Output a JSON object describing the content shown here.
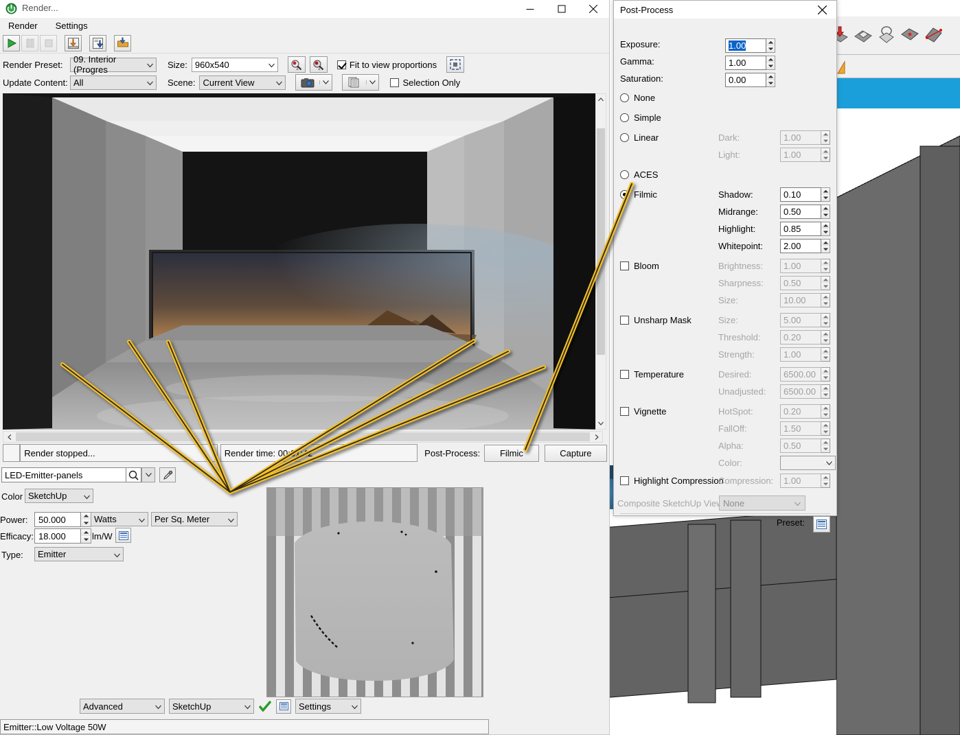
{
  "window": {
    "title": "Render...",
    "app_icon": "power-icon",
    "minimize": "minimize-icon",
    "maximize": "maximize-icon",
    "close": "close-icon"
  },
  "menu": {
    "items": [
      "Render",
      "Settings"
    ]
  },
  "toolbar": {
    "buttons": [
      {
        "name": "play-render-button",
        "icon": "play-icon",
        "enabled": true
      },
      {
        "name": "pause-render-button",
        "icon": "pause-icon",
        "enabled": false
      },
      {
        "name": "stop-render-button",
        "icon": "stop-icon",
        "enabled": false
      },
      {
        "name": "save-image-button",
        "icon": "save-image-icon",
        "enabled": true
      },
      {
        "name": "save-channels-button",
        "icon": "save-channels-icon",
        "enabled": true
      },
      {
        "name": "open-image-button",
        "icon": "open-folder-icon",
        "enabled": true
      }
    ]
  },
  "options": {
    "render_preset_label": "Render Preset:",
    "render_preset_value": "09. Interior (Progres",
    "size_label": "Size:",
    "size_value": "960x540",
    "update_content_label": "Update Content:",
    "update_content_value": "All",
    "scene_label": "Scene:",
    "scene_value": "Current View",
    "fit_to_view_label": "Fit to view proportions",
    "fit_to_view_checked": true,
    "selection_only_label": "Selection Only",
    "selection_only_checked": false,
    "zoom_in_icon": "zoom-in-icon",
    "zoom_out_icon": "zoom-out-icon",
    "fit_region_icon": "fit-region-icon",
    "camera_icon": "camera-icon",
    "channels_icon": "channels-icon"
  },
  "status": {
    "render_state": "Render stopped...",
    "render_time": "Render time: 00:01:42",
    "post_process_label": "Post-Process:",
    "post_process_value": "Filmic",
    "capture_label": "Capture"
  },
  "material": {
    "name": "LED-Emitter-panels",
    "search_icon": "search-icon",
    "dropdown_icon": "chevron-down-icon",
    "picker_icon": "eyedropper-icon",
    "color_label": "Color",
    "color_value": "SketchUp",
    "power_label": "Power:",
    "power_value": "50.000",
    "power_unit": "Watts",
    "power_area": "Per Sq. Meter",
    "efficacy_label": "Efficacy:",
    "efficacy_value": "18.000",
    "efficacy_unit": "lm/W",
    "efficacy_list_icon": "list-icon",
    "type_label": "Type:",
    "type_value": "Emitter",
    "bottom_mode": "Advanced",
    "bottom_source": "SketchUp",
    "apply_icon": "green-check-icon",
    "list_icon": "list-icon",
    "settings_label": "Settings",
    "statusbar_text": "Emitter::Low Voltage 50W"
  },
  "post_process": {
    "title": "Post-Process",
    "close_icon": "close-icon",
    "exposure_label": "Exposure:",
    "exposure_value": "1.00",
    "gamma_label": "Gamma:",
    "gamma_value": "1.00",
    "saturation_label": "Saturation:",
    "saturation_value": "0.00",
    "tonemap_options": [
      {
        "label": "None",
        "selected": false
      },
      {
        "label": "Simple",
        "selected": false
      },
      {
        "label": "Linear",
        "selected": false
      },
      {
        "label": "ACES",
        "selected": false
      },
      {
        "label": "Filmic",
        "selected": true
      }
    ],
    "linear_params": [
      {
        "label": "Dark:",
        "value": "1.00",
        "enabled": false
      },
      {
        "label": "Light:",
        "value": "1.00",
        "enabled": false
      }
    ],
    "filmic_params": [
      {
        "label": "Shadow:",
        "value": "0.10",
        "enabled": true
      },
      {
        "label": "Midrange:",
        "value": "0.50",
        "enabled": true
      },
      {
        "label": "Highlight:",
        "value": "0.85",
        "enabled": true
      },
      {
        "label": "Whitepoint:",
        "value": "2.00",
        "enabled": true
      }
    ],
    "bloom_label": "Bloom",
    "bloom_checked": false,
    "bloom_params": [
      {
        "label": "Brightness:",
        "value": "1.00",
        "enabled": false
      },
      {
        "label": "Sharpness:",
        "value": "0.50",
        "enabled": false
      },
      {
        "label": "Size:",
        "value": "10.00",
        "enabled": false
      }
    ],
    "unsharp_label": "Unsharp Mask",
    "unsharp_checked": false,
    "unsharp_params": [
      {
        "label": "Size:",
        "value": "5.00",
        "enabled": false
      },
      {
        "label": "Threshold:",
        "value": "0.20",
        "enabled": false
      },
      {
        "label": "Strength:",
        "value": "1.00",
        "enabled": false
      }
    ],
    "temperature_label": "Temperature",
    "temperature_checked": false,
    "temperature_params": [
      {
        "label": "Desired:",
        "value": "6500.00",
        "enabled": false
      },
      {
        "label": "Unadjusted:",
        "value": "6500.00",
        "enabled": false
      }
    ],
    "vignette_label": "Vignette",
    "vignette_checked": false,
    "vignette_params": [
      {
        "label": "HotSpot:",
        "value": "0.20",
        "enabled": false
      },
      {
        "label": "FallOff:",
        "value": "1.50",
        "enabled": false
      },
      {
        "label": "Alpha:",
        "value": "0.50",
        "enabled": false
      }
    ],
    "vignette_color_label": "Color:",
    "vignette_color_value": "#000000",
    "highlight_compression_label": "Highlight Compression",
    "highlight_compression_checked": false,
    "compression_label": "Compression:",
    "compression_value": "1.00",
    "composite_label": "Composite SketchUp View:",
    "composite_value": "None",
    "preset_label": "Preset:",
    "preset_icon": "preset-list-icon"
  },
  "annotations": {
    "color": "#f5c022",
    "arrow_count": 7,
    "description": "yellow callout arrows pointing to ceiling LED emitter panels and from Filmic button to Filmic radio"
  }
}
